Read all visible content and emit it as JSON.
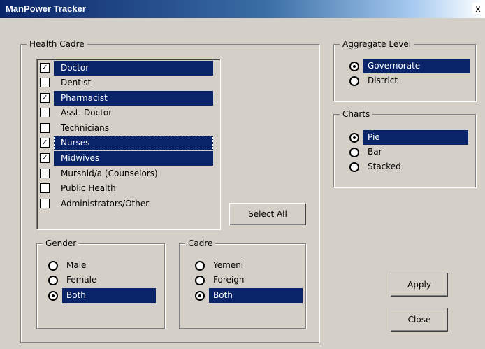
{
  "window": {
    "title": "ManPower Tracker",
    "close_label": "x"
  },
  "health_cadre": {
    "legend": "Health Cadre",
    "items": [
      {
        "label": "Doctor",
        "checked": true
      },
      {
        "label": "Dentist",
        "checked": false
      },
      {
        "label": "Pharmacist",
        "checked": true
      },
      {
        "label": "Asst. Doctor",
        "checked": false
      },
      {
        "label": "Technicians",
        "checked": false
      },
      {
        "label": "Nurses",
        "checked": true
      },
      {
        "label": "Midwives",
        "checked": true
      },
      {
        "label": "Murshid/a (Counselors)",
        "checked": false
      },
      {
        "label": "Public Health",
        "checked": false
      },
      {
        "label": "Administrators/Other",
        "checked": false
      }
    ],
    "select_all_label": "Select All"
  },
  "gender": {
    "legend": "Gender",
    "options": [
      "Male",
      "Female",
      "Both"
    ],
    "selected": "Both"
  },
  "cadre": {
    "legend": "Cadre",
    "options": [
      "Yemeni",
      "Foreign",
      "Both"
    ],
    "selected": "Both"
  },
  "aggregate_level": {
    "legend": "Aggregate Level",
    "options": [
      "Governorate",
      "District"
    ],
    "selected": "Governorate"
  },
  "charts": {
    "legend": "Charts",
    "options": [
      "Pie",
      "Bar",
      "Stacked"
    ],
    "selected": "Pie"
  },
  "buttons": {
    "apply": "Apply",
    "close": "Close"
  },
  "colors": {
    "selection": "#0a246a",
    "face": "#d4d0c8"
  }
}
